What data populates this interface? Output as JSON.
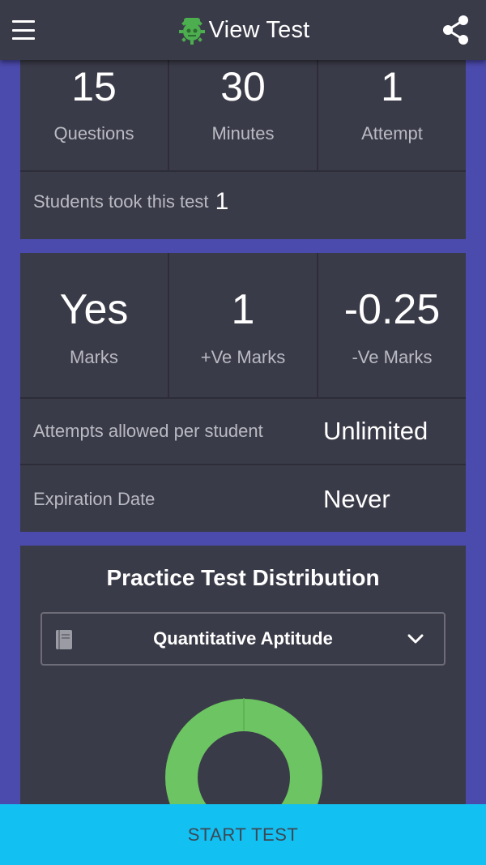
{
  "appbar": {
    "title": "View Test",
    "icons": {
      "menu": "menu-icon",
      "logo": "robot-logo-icon",
      "share": "share-icon"
    }
  },
  "summary": {
    "stats": [
      {
        "value": "15",
        "label": "Questions"
      },
      {
        "value": "30",
        "label": "Minutes"
      },
      {
        "value": "1",
        "label": "Attempt"
      }
    ],
    "students_label": "Students took this test",
    "students_count": "1"
  },
  "marking": {
    "stats": [
      {
        "value": "Yes",
        "label": "Marks"
      },
      {
        "value": "1",
        "label": "+Ve Marks"
      },
      {
        "value": "-0.25",
        "label": "-Ve Marks"
      }
    ],
    "attempts_label": "Attempts allowed per student",
    "attempts_value": "Unlimited",
    "expiration_label": "Expiration Date",
    "expiration_value": "Never"
  },
  "distribution": {
    "title": "Practice Test Distribution",
    "selected_subject": "Quantitative Aptitude",
    "icons": {
      "subject": "book-icon",
      "dropdown": "chevron-down-icon"
    }
  },
  "footer": {
    "start_label": "START TEST"
  },
  "colors": {
    "background": "#4b4aad",
    "card": "#3a3b48",
    "accent_button": "#13c0f2",
    "donut": "#6cc462",
    "logo": "#4cae4f"
  }
}
